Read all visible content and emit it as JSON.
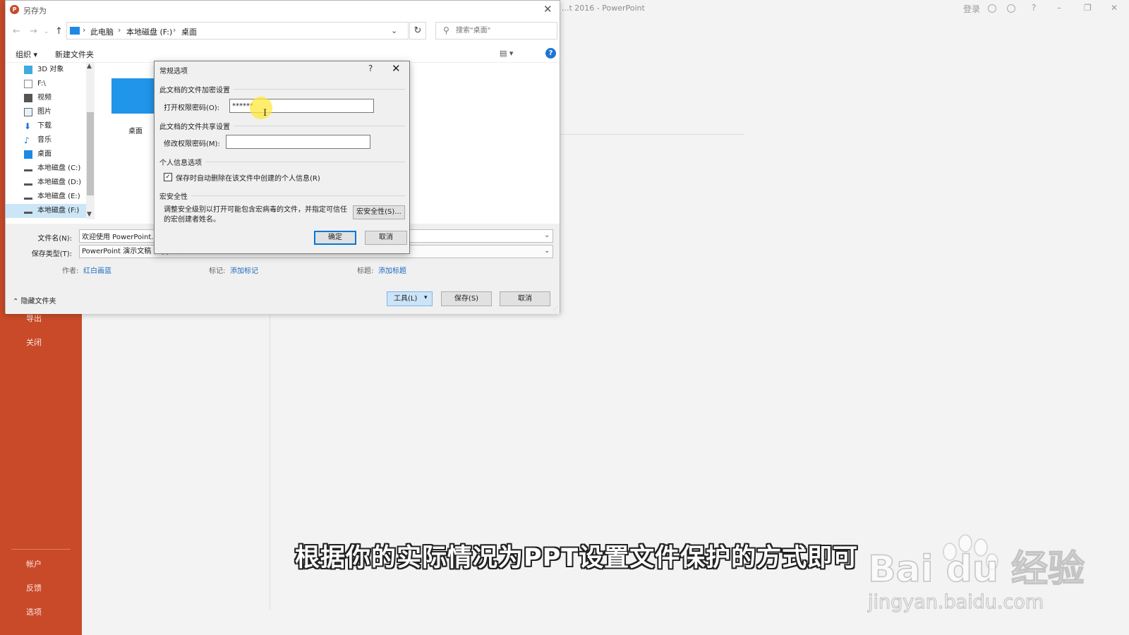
{
  "ppt": {
    "title": "...t 2016  -  PowerPoint",
    "signin": "登录",
    "sidebar": {
      "export": "导出",
      "close": "关闭",
      "account": "帐户",
      "feedback": "反馈",
      "options": "选项"
    }
  },
  "save_as": {
    "title": "另存为",
    "address": {
      "crumbs": [
        "此电脑",
        "本地磁盘 (F:)",
        "桌面"
      ]
    },
    "search": {
      "placeholder": "搜索\"桌面\""
    },
    "toolbar": {
      "organize": "组织 ▾",
      "new_folder": "新建文件夹"
    },
    "tree": [
      {
        "label": "3D 对象",
        "icon": "3d-objects-icon"
      },
      {
        "label": "F:\\",
        "icon": "drive-icon"
      },
      {
        "label": "视频",
        "icon": "video-icon"
      },
      {
        "label": "图片",
        "icon": "pictures-icon"
      },
      {
        "label": "下载",
        "icon": "download-icon"
      },
      {
        "label": "音乐",
        "icon": "music-icon"
      },
      {
        "label": "桌面",
        "icon": "desktop-icon"
      },
      {
        "label": "本地磁盘 (C:)",
        "icon": "drive-icon"
      },
      {
        "label": "本地磁盘 (D:)",
        "icon": "drive-icon"
      },
      {
        "label": "本地磁盘 (E:)",
        "icon": "drive-icon"
      },
      {
        "label": "本地磁盘 (F:)",
        "icon": "drive-icon",
        "selected": true
      }
    ],
    "content": {
      "folder_label": "桌面"
    },
    "fields": {
      "filename_label": "文件名(N):",
      "filename_value": "欢迎使用 PowerPoint.pptx",
      "type_label": "保存类型(T):",
      "type_value": "PowerPoint 演示文稿 (*.pptx)",
      "author_label": "作者:",
      "author_value": "红白画蓝",
      "tags_label": "标记:",
      "tags_value": "添加标记",
      "title_label": "标题:",
      "title_value": "添加标题"
    },
    "hide_folders": "隐藏文件夹",
    "buttons": {
      "tools": "工具(L)",
      "save": "保存(S)",
      "cancel": "取消"
    }
  },
  "general_options": {
    "title": "常规选项",
    "encrypt_section": "此文档的文件加密设置",
    "open_password_label": "打开权限密码(O):",
    "open_password_value": "******",
    "share_section": "此文档的文件共享设置",
    "modify_password_label": "修改权限密码(M):",
    "modify_password_value": "",
    "privacy_section": "个人信息选项",
    "privacy_checkbox_label": "保存时自动删除在该文件中创建的个人信息(R)",
    "privacy_checked": true,
    "macro_section": "宏安全性",
    "macro_text": "调整安全级别以打开可能包含宏病毒的文件，并指定可信任的宏创建者姓名。",
    "macro_button": "宏安全性(S)...",
    "ok": "确定",
    "cancel": "取消"
  },
  "caption": "根据你的实际情况为PPT设置文件保护的方式即可",
  "watermark": {
    "brand": "Bai du 经验",
    "url": "jingyan.baidu.com"
  },
  "colors": {
    "ppt_accent": "#c84a29",
    "link": "#1e6cc0",
    "focus": "#0078d7",
    "highlight": "#ffe83c"
  }
}
